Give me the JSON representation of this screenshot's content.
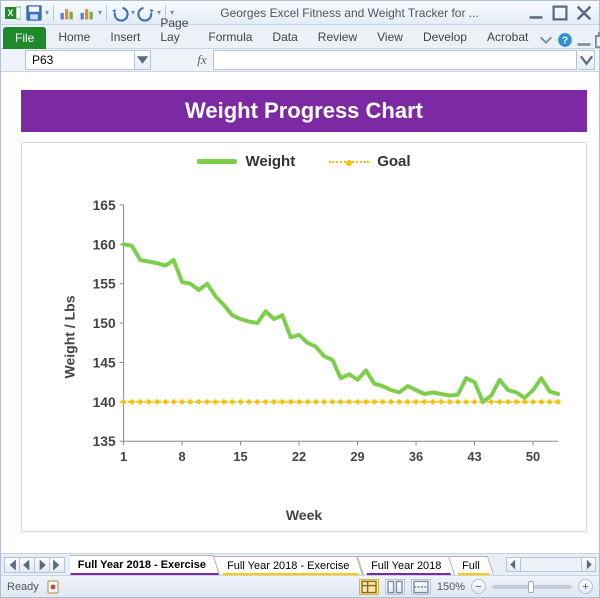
{
  "titlebar": {
    "app_title": "Georges Excel Fitness and Weight Tracker for ..."
  },
  "ribbon": {
    "file": "File",
    "tabs": [
      "Home",
      "Insert",
      "Page Lay",
      "Formula",
      "Data",
      "Review",
      "View",
      "Develop",
      "Acrobat"
    ]
  },
  "formula_bar": {
    "name_box": "P63",
    "fx": "fx",
    "formula": ""
  },
  "chart_data": {
    "type": "line",
    "title": "Weight Progress Chart",
    "xlabel": "Week",
    "ylabel": "Weight / Lbs",
    "x": [
      1,
      2,
      3,
      4,
      5,
      6,
      7,
      8,
      9,
      10,
      11,
      12,
      13,
      14,
      15,
      16,
      17,
      18,
      19,
      20,
      21,
      22,
      23,
      24,
      25,
      26,
      27,
      28,
      29,
      30,
      31,
      32,
      33,
      34,
      35,
      36,
      37,
      38,
      39,
      40,
      41,
      42,
      43,
      44,
      45,
      46,
      47,
      48,
      49,
      50,
      51,
      52,
      53
    ],
    "series": [
      {
        "name": "Weight",
        "values": [
          160,
          159.8,
          158,
          157.8,
          157.6,
          157.3,
          158,
          155.2,
          155,
          154.2,
          155,
          153.4,
          152.3,
          151,
          150.5,
          150.2,
          150,
          151.5,
          150.5,
          151,
          148.2,
          148.5,
          147.5,
          147,
          145.8,
          145.3,
          143,
          143.5,
          142.8,
          144,
          142.3,
          142,
          141.5,
          141.2,
          142,
          141.5,
          141,
          141.2,
          141,
          140.8,
          140.9,
          143,
          142.5,
          140,
          140.8,
          142.8,
          141.5,
          141.2,
          140.5,
          141.5,
          143,
          141.3,
          141
        ]
      },
      {
        "name": "Goal",
        "values": [
          140,
          140,
          140,
          140,
          140,
          140,
          140,
          140,
          140,
          140,
          140,
          140,
          140,
          140,
          140,
          140,
          140,
          140,
          140,
          140,
          140,
          140,
          140,
          140,
          140,
          140,
          140,
          140,
          140,
          140,
          140,
          140,
          140,
          140,
          140,
          140,
          140,
          140,
          140,
          140,
          140,
          140,
          140,
          140,
          140,
          140,
          140,
          140,
          140,
          140,
          140,
          140,
          140
        ]
      }
    ],
    "ylim": [
      135,
      165
    ],
    "yticks": [
      135,
      140,
      145,
      150,
      155,
      160,
      165
    ],
    "xticks": [
      1,
      8,
      15,
      22,
      29,
      36,
      43,
      50
    ],
    "legend_position": "top",
    "colors": {
      "Weight": "#7dce4a",
      "Goal": "#f4c20d"
    }
  },
  "sheet_tabs": {
    "items": [
      {
        "label": "Full Year 2018 - Exercise",
        "active": true,
        "accent": "purple"
      },
      {
        "label": "Full Year 2018 - Exercise",
        "active": false,
        "accent": "yellow"
      },
      {
        "label": "Full Year 2018",
        "active": false,
        "accent": "purple"
      },
      {
        "label": "Full",
        "active": false,
        "accent": "yellow"
      }
    ]
  },
  "statusbar": {
    "ready": "Ready",
    "zoom": "150%"
  }
}
